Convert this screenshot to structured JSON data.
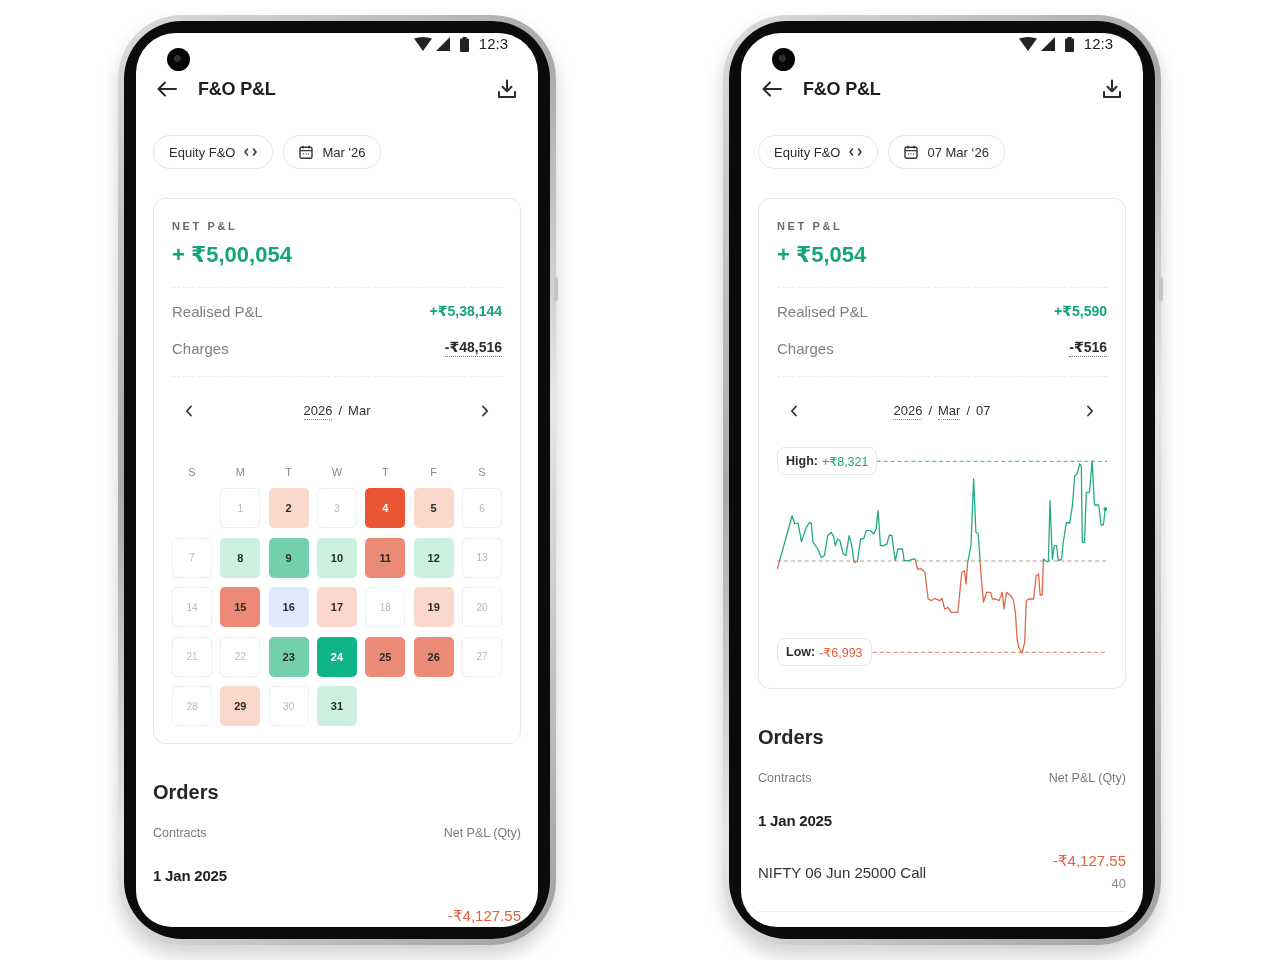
{
  "phones": [
    {
      "status_bar": {
        "time": "12:3"
      },
      "header": {
        "title": "F&O P&L"
      },
      "filters": {
        "segment": "Equity F&O",
        "date": "Mar '26"
      },
      "summary": {
        "label": "NET P&L",
        "net": "+ ₹5,00,054",
        "rows": [
          {
            "label": "Realised P&L",
            "value": "+₹5,38,144",
            "kind": "gain"
          },
          {
            "label": "Charges",
            "value": "-₹48,516",
            "kind": "charges"
          }
        ]
      },
      "navigator": {
        "crumbs": [
          {
            "text": "2026",
            "dotted": true
          },
          {
            "text": "/",
            "dotted": false
          },
          {
            "text": "Mar",
            "dotted": false
          }
        ]
      },
      "view": {
        "kind": "calendar",
        "weekdays": [
          "S",
          "M",
          "T",
          "W",
          "T",
          "F",
          "S"
        ],
        "weeks": [
          {
            "days": [
              {
                "day": "1",
                "traded": false
              },
              {
                "day": "2",
                "traded": true,
                "color": "#fcd8cc"
              },
              {
                "day": "3",
                "traded": false
              },
              {
                "day": "4",
                "traded": true,
                "color": "#ea5533"
              },
              {
                "day": "5",
                "traded": true,
                "color": "#fcd8cc"
              },
              {
                "day": "6",
                "traded": false
              }
            ]
          },
          {
            "days": [
              {
                "day": "7",
                "traded": false
              },
              {
                "day": "8",
                "traded": true,
                "color": "#cdf1e1"
              },
              {
                "day": "9",
                "traded": true,
                "color": "#74cfac"
              },
              {
                "day": "10",
                "traded": true,
                "color": "#cdf1e1"
              },
              {
                "day": "11",
                "traded": true,
                "color": "#eb8a76"
              },
              {
                "day": "12",
                "traded": true,
                "color": "#cdf1e1"
              },
              {
                "day": "13",
                "traded": false
              }
            ]
          },
          {
            "days": [
              {
                "day": "14",
                "traded": false
              },
              {
                "day": "15",
                "traded": true,
                "color": "#eb8a76"
              },
              {
                "day": "16",
                "traded": true,
                "color": "#e0e8fb"
              },
              {
                "day": "17",
                "traded": true,
                "color": "#fcd8cc"
              },
              {
                "day": "18",
                "traded": false
              },
              {
                "day": "19",
                "traded": true,
                "color": "#fcd8cc"
              },
              {
                "day": "20",
                "traded": false
              }
            ]
          },
          {
            "days": [
              {
                "day": "21",
                "traded": false
              },
              {
                "day": "22",
                "traded": false
              },
              {
                "day": "23",
                "traded": true,
                "color": "#74cfac"
              },
              {
                "day": "24",
                "traded": true,
                "color": "#10b48a"
              },
              {
                "day": "25",
                "traded": true,
                "color": "#eb8a76"
              },
              {
                "day": "26",
                "traded": true,
                "color": "#eb8a76"
              },
              {
                "day": "27",
                "traded": false
              }
            ]
          },
          {
            "days": [
              {
                "day": "28",
                "traded": false
              },
              {
                "day": "29",
                "traded": true,
                "color": "#fcd8cc"
              },
              {
                "day": "30",
                "traded": false
              },
              {
                "day": "31",
                "traded": true,
                "color": "#cdf1e1"
              }
            ]
          }
        ]
      },
      "orders": {
        "title": "Orders",
        "columns": [
          "Contracts",
          "Net P&L (Qty)"
        ],
        "groups": [
          {
            "date": "1 Jan 2025",
            "rows": [
              {
                "amount": "-₹4,127.55"
              }
            ]
          }
        ]
      }
    },
    {
      "status_bar": {
        "time": "12:3"
      },
      "header": {
        "title": "F&O P&L"
      },
      "filters": {
        "segment": "Equity F&O",
        "date": "07 Mar ‘26"
      },
      "summary": {
        "label": "NET P&L",
        "net": "+ ₹5,054",
        "rows": [
          {
            "label": "Realised P&L",
            "value": "+₹5,590",
            "kind": "gain"
          },
          {
            "label": "Charges",
            "value": "-₹516",
            "kind": "charges"
          }
        ]
      },
      "navigator": {
        "crumbs": [
          {
            "text": "2026",
            "dotted": true
          },
          {
            "text": "/",
            "dotted": false
          },
          {
            "text": "Mar",
            "dotted": true
          },
          {
            "text": "/",
            "dotted": false
          },
          {
            "text": "07",
            "dotted": false
          }
        ]
      },
      "view": {
        "kind": "intraday_chart",
        "high_label": "High:",
        "high": "+₹8,321",
        "low_label": "Low:",
        "low": "-₹6,993"
      },
      "orders": {
        "title": "Orders",
        "columns": [
          "Contracts",
          "Net P&L (Qty)"
        ],
        "groups": [
          {
            "date": "1 Jan 2025",
            "rows": [
              {
                "contract": "NIFTY 06 Jun 25000 Call",
                "amount": "-₹4,127.55",
                "qty": "40"
              }
            ]
          }
        ]
      }
    }
  ]
}
